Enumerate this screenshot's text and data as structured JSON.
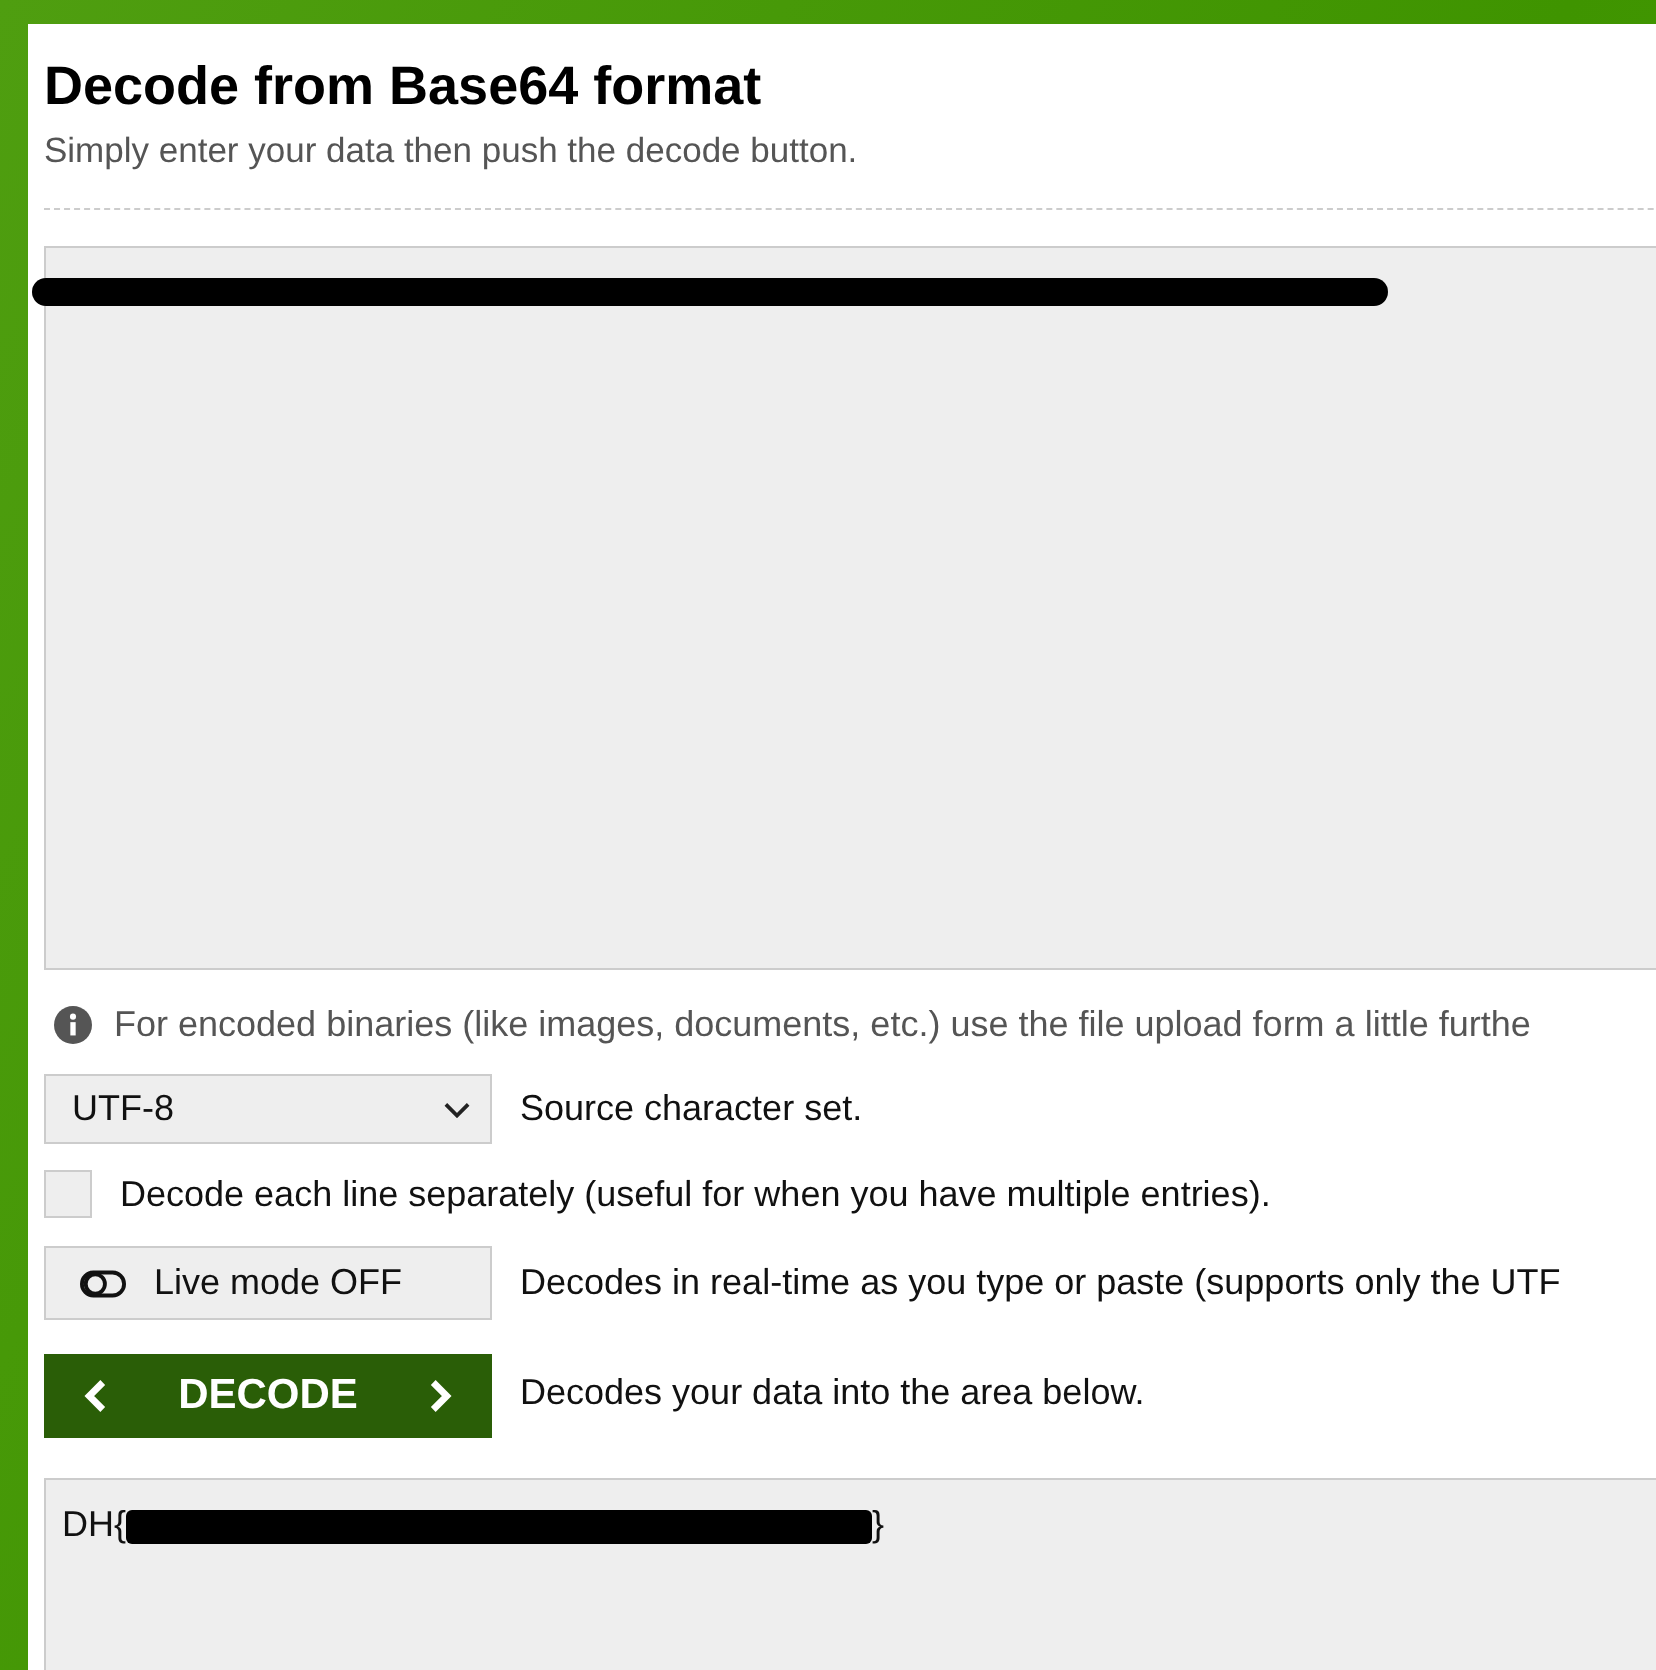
{
  "title": "Decode from Base64 format",
  "subtitle": "Simply enter your data then push the decode button.",
  "input": {
    "redacted": true
  },
  "notice": "For encoded binaries (like images, documents, etc.) use the file upload form a little furthe",
  "charset": {
    "value": "UTF-8",
    "label": "Source character set."
  },
  "line_option": {
    "checked": false,
    "label": "Decode each line separately (useful for when you have multiple entries)."
  },
  "live_mode": {
    "on": false,
    "label": "Live mode OFF",
    "description": "Decodes in real-time as you type or paste (supports only the UTF"
  },
  "decode": {
    "label": "DECODE",
    "description": "Decodes your data into the area below."
  },
  "output": {
    "prefix": "DH{",
    "redacted": true,
    "suffix": "}"
  }
}
